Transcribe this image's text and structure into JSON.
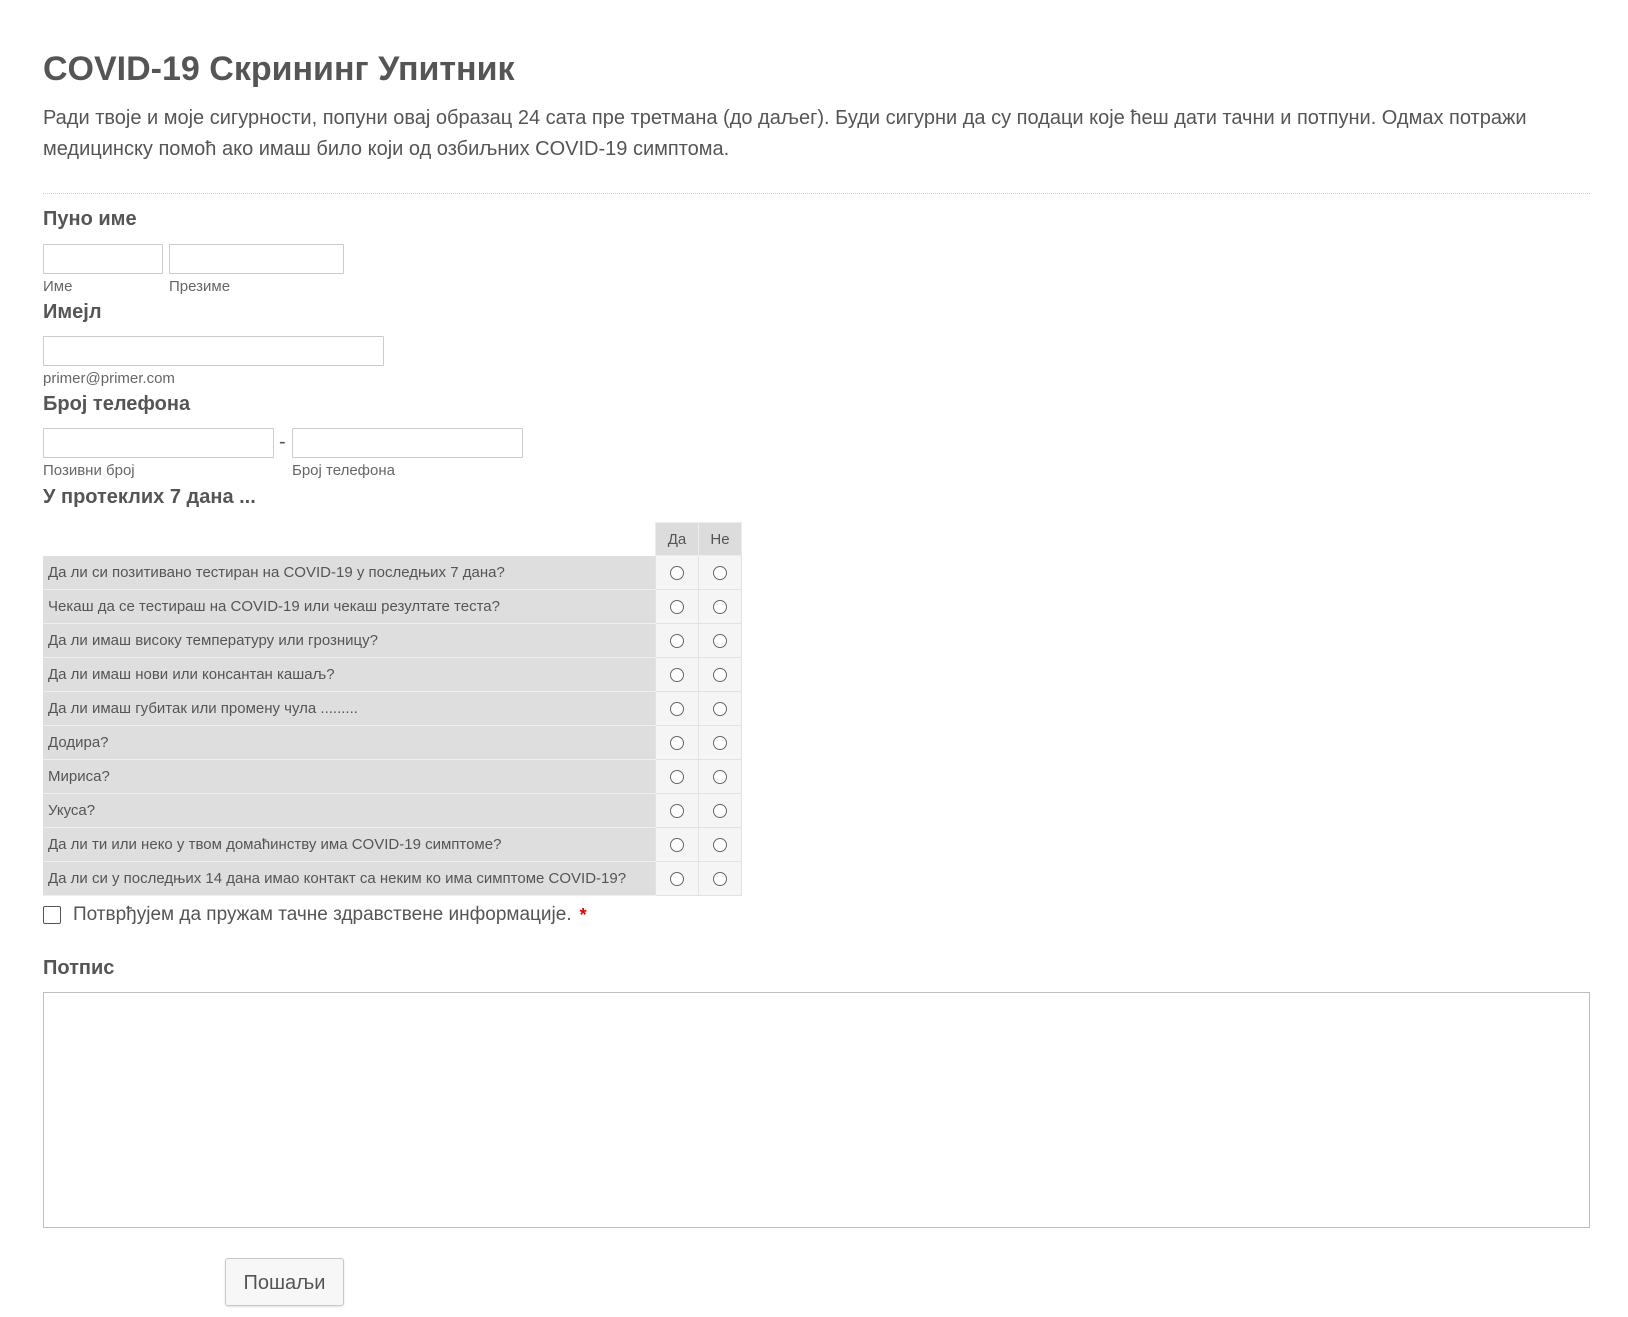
{
  "form": {
    "title": "COVID-19 Скрининг Упитник",
    "intro": "Ради твоје и моје сигурности, попуни овај образац 24 сата пре третмана (до даљег). Буди сигурни да су подаци које ћеш дати тачни и потпуни. Одмах потражи медицинску помоћ ако имаш било који од озбиљних COVID-19 симптома."
  },
  "full_name": {
    "label": "Пуно име",
    "first_value": "",
    "first_sublabel": "Име",
    "last_value": "",
    "last_sublabel": "Презиме"
  },
  "email": {
    "label": "Имејл",
    "value": "",
    "sublabel": "primer@primer.com"
  },
  "phone": {
    "label": "Број телефона",
    "area_value": "",
    "area_sublabel": "Позивни број",
    "separator": "-",
    "number_value": "",
    "number_sublabel": "Број телефона"
  },
  "matrix": {
    "label": "У протеклих 7 дана ...",
    "columns": [
      "Да",
      "Не"
    ],
    "rows": [
      "Да ли си позитивано тестиран на COVID-19 у последњих 7 дана?",
      "Чекаш да се тестираш на COVID-19 или чекаш резултате теста?",
      "Да ли имаш високу температуру или грозницу?",
      "Да ли имаш нови или консантан кашаљ?",
      "Да ли имаш губитак или промену чула .........",
      "Додира?",
      "Мириса?",
      "Укуса?",
      "Да ли ти или неко у твом домаћинству има COVID-19 симптоме?",
      "Да ли си у последњих 14 дана имао контакт са неким ко има симптоме COVID-19?"
    ]
  },
  "confirm": {
    "text": "Потврђујем да пружам тачне здравствене информације.",
    "required_mark": "*",
    "checked": false
  },
  "signature": {
    "label": "Потпис"
  },
  "submit": {
    "label": "Пошаљи"
  }
}
